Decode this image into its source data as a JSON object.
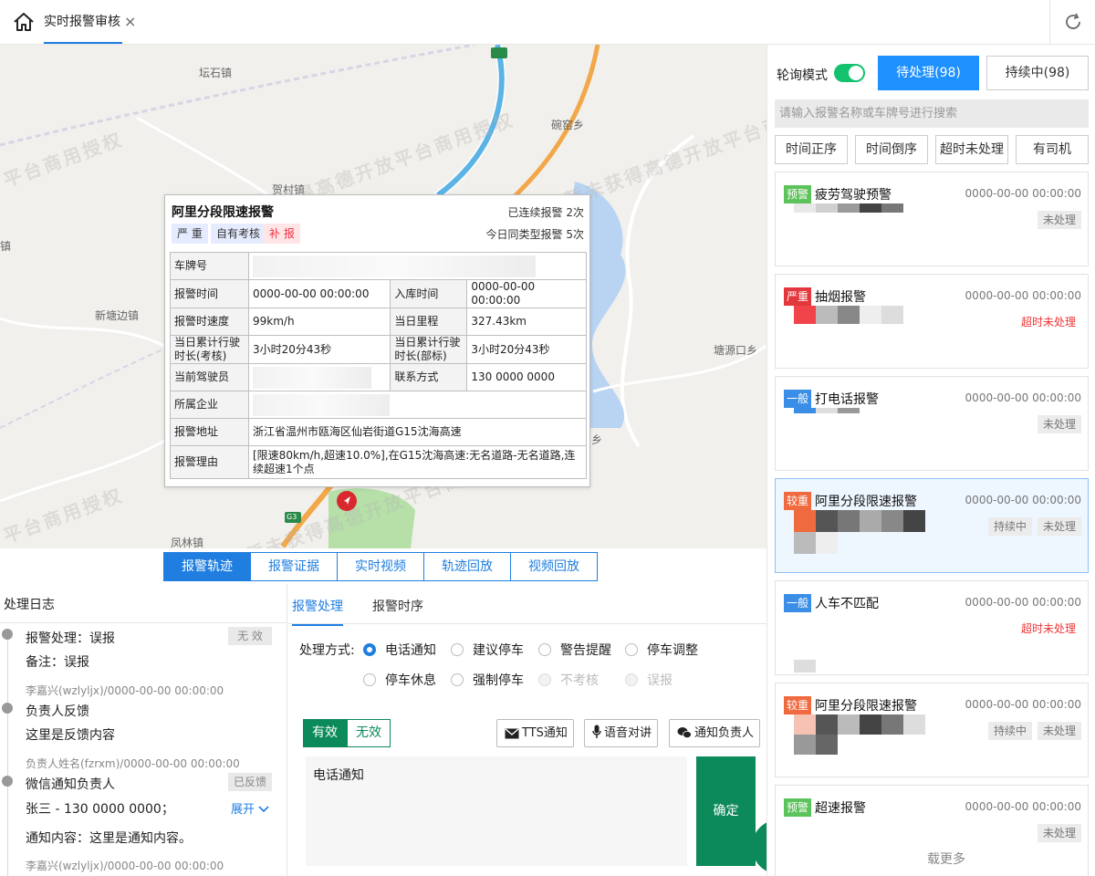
{
  "tab": {
    "title": "实时报警审核",
    "close": "×"
  },
  "map": {
    "places": [
      "坛石镇",
      "碗窑乡",
      "贺村镇",
      "新塘边镇",
      "塘源口乡",
      "凤林镇",
      "镇",
      "乡"
    ],
    "road_labels": [
      "G3"
    ],
    "watermark": "平台商用授权",
    "watermark2": "暂未获得高德开放平台商用授权"
  },
  "popup": {
    "title": "阿里分段限速报警",
    "consecutive": "已连续报警 2次",
    "same_type_today": "今日同类型报警 5次",
    "tags": [
      "严 重",
      "自有考核",
      "补 报"
    ],
    "rows": {
      "plate_label": "车牌号",
      "alarm_time_label": "报警时间",
      "alarm_time": "0000-00-00 00:00:00",
      "storage_time_label": "入库时间",
      "storage_time": "0000-00-00 00:00:00",
      "speed_label": "报警时速度",
      "speed": "99km/h",
      "mileage_label": "当日里程",
      "mileage": "327.43km",
      "drive_exam_label": "当日累计行驶时长(考核)",
      "drive_exam": "3小时20分43秒",
      "drive_dept_label": "当日累计行驶时长(部标)",
      "drive_dept": "3小时20分43秒",
      "driver_label": "当前驾驶员",
      "contact_label": "联系方式",
      "contact": "130 0000 0000",
      "company_label": "所属企业",
      "address_label": "报警地址",
      "address": "浙江省温州市瓯海区仙岩街道G15沈海高速",
      "reason_label": "报警理由",
      "reason": "[限速80km/h,超速10.0%],在G15沈海高速:无名道路-无名道路,连续超速1个点"
    }
  },
  "bottom_tabs": [
    "报警轨迹",
    "报警证据",
    "实时视频",
    "轨迹回放",
    "视频回放"
  ],
  "log": {
    "title": "处理日志",
    "items": [
      {
        "text": "报警处理：误报",
        "badge": "无 效",
        "note": "备注：误报"
      },
      {
        "meta": "李嘉兴(wzlyljx)/0000-00-00 00:00:00"
      },
      {
        "text": "负责人反馈",
        "note": "这里是反馈内容"
      },
      {
        "meta": "负责人姓名(fzrxm)/0000-00-00 00:00:00"
      },
      {
        "text": "微信通知负责人",
        "badge": "已反馈",
        "note": "张三 - 130 0000 0000；",
        "expand": "展开",
        "content": "通知内容：这里是通知内容。"
      },
      {
        "meta": "李嘉兴(wzlyljx)/0000-00-00 00:00:00"
      }
    ]
  },
  "process": {
    "tabs": [
      "报警处理",
      "报警时序"
    ],
    "method_label": "处理方式:",
    "options": [
      "电话通知",
      "建议停车",
      "警告提醒",
      "停车调整",
      "停车休息",
      "强制停车",
      "不考核",
      "误报"
    ],
    "valid": "有效",
    "invalid": "无效",
    "tts": "TTS通知",
    "voice": "语音对讲",
    "notify": "通知负责人",
    "textarea": "电话通知",
    "confirm": "确定"
  },
  "right": {
    "poll_label": "轮询模式",
    "pending": "待处理(98)",
    "ongoing": "持续中(98)",
    "search_placeholder": "请输入报警名称或车牌号进行搜索",
    "sorts": [
      "时间正序",
      "时间倒序",
      "超时未处理",
      "有司机"
    ],
    "cards": [
      {
        "level": "预警",
        "color": "#5cc25a",
        "title": "疲劳驾驶预警",
        "time": "0000-00-00 00:00:00",
        "status": [
          "未处理"
        ]
      },
      {
        "level": "严重",
        "color": "#e2373c",
        "title": "抽烟报警",
        "time": "0000-00-00 00:00:00",
        "status": [
          "超时未处理"
        ]
      },
      {
        "level": "一般",
        "color": "#3a8ee6",
        "title": "打电话报警",
        "time": "0000-00-00 00:00:00",
        "status": [
          "未处理"
        ]
      },
      {
        "level": "较重",
        "color": "#f06a3f",
        "title": "阿里分段限速报警",
        "time": "0000-00-00 00:00:00",
        "status": [
          "持续中",
          "未处理"
        ]
      },
      {
        "level": "一般",
        "color": "#3a8ee6",
        "title": "人车不匹配",
        "time": "0000-00-00 00:00:00",
        "status": [
          "超时未处理"
        ]
      },
      {
        "level": "较重",
        "color": "#f06a3f",
        "title": "阿里分段限速报警",
        "time": "0000-00-00 00:00:00",
        "status": [
          "持续中",
          "未处理"
        ]
      },
      {
        "level": "预警",
        "color": "#5cc25a",
        "title": "超速报警",
        "time": "0000-00-00 00:00:00",
        "status": [
          "未处理"
        ]
      }
    ],
    "load_more": "载更多"
  },
  "colors": {
    "primary": "#1f7ee0",
    "green": "#0d8a5a",
    "switch": "#13c26e"
  }
}
